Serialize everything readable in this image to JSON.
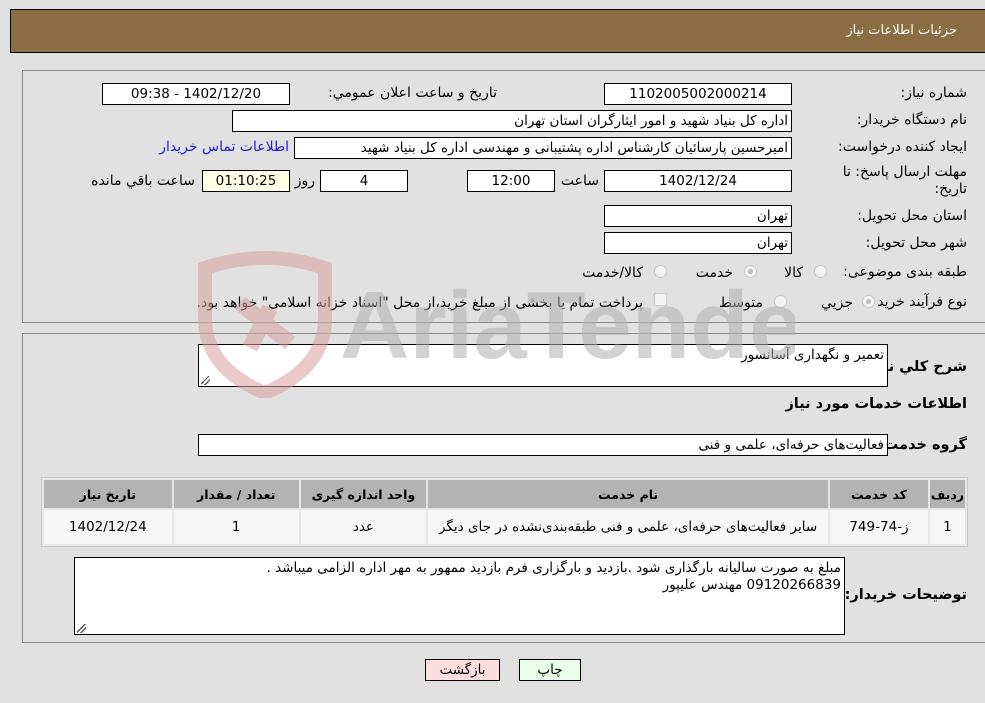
{
  "header": {
    "title": "جزئیات اطلاعات نیاز"
  },
  "fields": {
    "need_number": {
      "label": "شماره نیاز:",
      "value": "1102005002000214"
    },
    "announce_datetime": {
      "label": "تاریخ و ساعت اعلان عمومي:",
      "value": "1402/12/20 - 09:38"
    },
    "buyer_org": {
      "label": "نام دستگاه خریدار:",
      "value": "اداره کل بنیاد شهید و امور ایثارگران استان تهران"
    },
    "requester": {
      "label": "ایجاد کننده درخواست:",
      "value": "امیرحسین پارسائیان کارشناس اداره پشتیبانی و مهندسی  اداره کل بنیاد شهید"
    },
    "buyer_contact_link": "اطلاعات تماس خریدار",
    "deadline": {
      "label": "مهلت ارسال پاسخ: تا تاریخ:",
      "date": "1402/12/24",
      "time_label": "ساعت",
      "time": "12:00",
      "days": "4",
      "days_label": "روز و",
      "remaining": "01:10:25",
      "remaining_label": "ساعت باقي مانده"
    },
    "delivery_province": {
      "label": "استان محل تحویل:",
      "value": "تهران"
    },
    "delivery_city": {
      "label": "شهر محل تحویل:",
      "value": "تهران"
    },
    "category": {
      "label": "طبقه بندی موضوعی:",
      "options": [
        "کالا",
        "خدمت",
        "کالا/خدمت"
      ],
      "selected": "خدمت"
    },
    "purchase_type": {
      "label": "نوع فرآیند خرید :",
      "options": [
        "جزیي",
        "متوسط"
      ],
      "selected": "جزیي",
      "treasury_note": "پرداخت تمام یا بخشی از مبلغ خرید،از محل \"اسناد خزانه اسلامی\" خواهد بود."
    }
  },
  "details": {
    "description_label": "شرح کلي نیاز:",
    "description": "تعمیر و نگهداری آسانسور",
    "services_title": "اطلاعات خدمات مورد نیاز",
    "service_group_label": "گروه خدمت:",
    "service_group": "فعالیت‌های حرفه‌ای، علمی و فنی",
    "table": {
      "headers": [
        "ردیف",
        "کد خدمت",
        "نام خدمت",
        "واحد اندازه گیری",
        "تعداد / مقدار",
        "تاریخ نیاز"
      ],
      "rows": [
        [
          "1",
          "ز-74-749",
          "سایر فعالیت‌های حرفه‌ای، علمی و فنی طبقه‌بندی‌نشده در جای دیگر",
          "عدد",
          "1",
          "1402/12/24"
        ]
      ]
    },
    "buyer_notes_label": "توضیحات خریدار:",
    "buyer_notes_line1": "مبلغ به صورت سالیانه بارگذاری شود .بازدید و بارگزاری فرم بازدید ممهور به مهر اداره الزامی میباشد .",
    "buyer_notes_line2": "09120266839 مهندس علیپور"
  },
  "buttons": {
    "print": "چاپ",
    "back": "بازگشت"
  },
  "watermark": "AriaTender.neT",
  "colors": {
    "header_bg": "#8c6c43",
    "link": "#2222cc",
    "print_bg": "#eaffea",
    "back_bg": "#ffdede",
    "remaining_bg": "#ffffe8"
  }
}
